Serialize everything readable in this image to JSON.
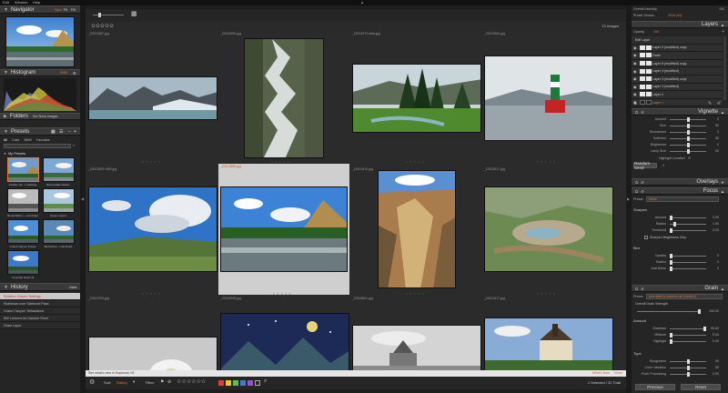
{
  "menubar": {
    "items": [
      "Edit",
      "Window",
      "Help"
    ]
  },
  "navigator": {
    "title": "Navigator",
    "controls": [
      "Sync",
      "Fit",
      "Fill"
    ]
  },
  "histogram": {
    "title": "Histogram",
    "mode": "RGB"
  },
  "folders": {
    "title": "Folders",
    "action": "Set Show Images"
  },
  "presets": {
    "title": "Presets",
    "tabs": [
      "All",
      "Color",
      "B&W",
      "Favorites"
    ],
    "group": "My Presets",
    "items": [
      {
        "label": "Inkstain Hit - 2 Settings"
      },
      {
        "label": "Barrowdale Master"
      },
      {
        "label": "Brown/Warm - Low Road"
      },
      {
        "label": "Green Layers"
      },
      {
        "label": "Grand Canyon Preset"
      },
      {
        "label": "Berkshires - Late Road"
      },
      {
        "label": "Yosemite Dusk Hit"
      }
    ]
  },
  "history": {
    "title": "History",
    "clear_label": "Clear",
    "items": [
      {
        "label": "Rotation Glacier Settings",
        "selected": true
      },
      {
        "label": "Rainbows over Starmont Pass",
        "selected": false
      },
      {
        "label": "Grand Canyon Yellowstone",
        "selected": false
      },
      {
        "label": "BW Lemons for Danube River",
        "selected": false
      },
      {
        "label": "Grain Layer",
        "selected": false
      }
    ]
  },
  "browser": {
    "count": "13 Images",
    "hint": "See what's new in Exposure X5",
    "whats_new": "What's New",
    "close": "Close",
    "status": "1 Selected / 32 Total",
    "sort_label": "Sort:",
    "sort_value": "Rating",
    "filter_label": "Filter:",
    "label_colors": [
      "#e23b3b",
      "#e8c63a",
      "#5fbf4a",
      "#3e7bd6",
      "#9a4fd1"
    ],
    "thumbs": [
      {
        "name": "_DSC5487.jpg",
        "kind": "glacier"
      },
      {
        "name": "_DSC5490.jpg",
        "kind": "waterfall"
      },
      {
        "name": "_DSC5973 beta.jpg",
        "kind": "forest"
      },
      {
        "name": "_DSC5962.jpg",
        "kind": "buoy"
      },
      {
        "name": "_DSC2809 HDR.jpg",
        "kind": "sky"
      },
      {
        "name": "_DSC4885.jpg",
        "kind": "river"
      },
      {
        "name": "_DSC0610.jpg",
        "kind": "canyon"
      },
      {
        "name": "_DSC5517.jpg",
        "kind": "geyser"
      },
      {
        "name": "_DSC3703.jpg",
        "kind": "flower"
      },
      {
        "name": "_DSC8908.jpg",
        "kind": "painting"
      },
      {
        "name": "_DSC6801.jpg",
        "kind": "bw"
      },
      {
        "name": "_DSC4417.jpg",
        "kind": "castle"
      }
    ]
  },
  "right": {
    "overall_intensity": "Overall Intensity",
    "overall_value": "100",
    "preset_version": "Preset Version",
    "preset_version_value": "2019 (v3)",
    "layers_title": "Layers",
    "opacity_label": "Opacity",
    "opacity_value": "100",
    "layers": [
      {
        "label": "Edit Layer",
        "swatch": "none"
      },
      {
        "label": "Layer 9 (modified) copy",
        "swatch": "w"
      },
      {
        "label": "Grain",
        "swatch": "w"
      },
      {
        "label": "Layer 8 (modified) copy",
        "swatch": "w"
      },
      {
        "label": "Layer 4 (modified)",
        "swatch": "w"
      },
      {
        "label": "Layer 4 (modified) copy",
        "swatch": "w"
      },
      {
        "label": "Layer 3 (modified)",
        "swatch": "w"
      },
      {
        "label": "Layer 2",
        "swatch": "w"
      },
      {
        "label": "Layer 1",
        "swatch": "b"
      }
    ],
    "vignette_title": "Vignette",
    "vignette_rows": [
      {
        "label": "Amount",
        "value": "0"
      },
      {
        "label": "Size",
        "value": "50"
      },
      {
        "label": "Roundness",
        "value": "0"
      },
      {
        "label": "Softness",
        "value": "50"
      },
      {
        "label": "Brightness",
        "value": "0"
      },
      {
        "label": "Lamp Size",
        "value": "50"
      }
    ],
    "highlight_location": "Highlight Location",
    "random_seed": "Random Seed",
    "random_seed_value": "1",
    "overlays_title": "Overlays",
    "focus_title": "Focus",
    "focus_preset_label": "Preset:",
    "focus_preset_value": "None",
    "sharpen_title": "Sharpen",
    "sharpen_rows": [
      {
        "label": "Amount",
        "value": "0.00"
      },
      {
        "label": "Radius",
        "value": "1.00"
      },
      {
        "label": "Threshold",
        "value": "0.00"
      }
    ],
    "sharpen_check": "Sharpen Brightness Only",
    "blur_title": "Blur",
    "blur_rows": [
      {
        "label": "Opacity",
        "value": "0"
      },
      {
        "label": "Radius",
        "value": "0"
      },
      {
        "label": "Add Noise",
        "value": "0"
      }
    ],
    "grain_title": "Grain",
    "grain_preset_label": "Preset:",
    "grain_preset_value": "Add detail to finished Lab (medium)",
    "overall_grain": "Overall Grain Strength",
    "overall_grain_value": "100.00",
    "amount_title": "Amount",
    "amount_rows": [
      {
        "label": "Shadows",
        "value": "95.82"
      },
      {
        "label": "Midtone",
        "value": "0.00"
      },
      {
        "label": "Highlight",
        "value": "0.00"
      }
    ],
    "type_title": "Type",
    "type_rows": [
      {
        "label": "Roughness",
        "value": "50"
      },
      {
        "label": "Color Variation",
        "value": "50"
      },
      {
        "label": "Push Processing",
        "value": "0.00"
      }
    ],
    "previous_label": "Previous",
    "reset_label": "Reset"
  }
}
